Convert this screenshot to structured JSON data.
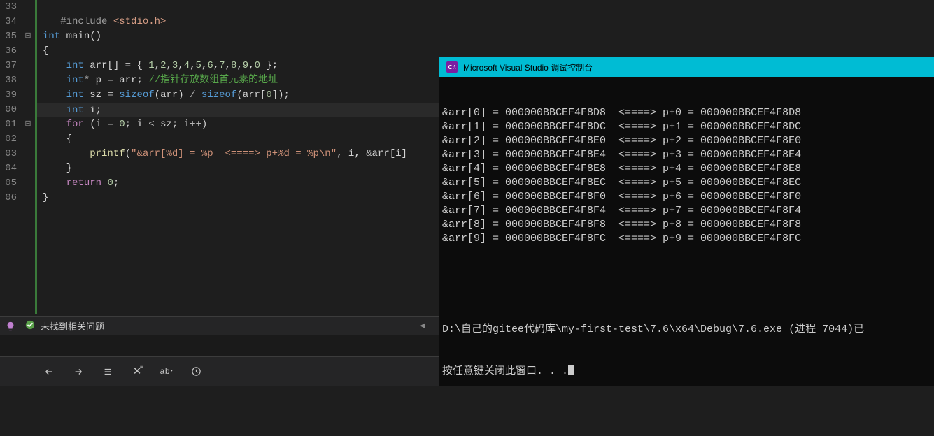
{
  "editor": {
    "lines": [
      {
        "num": "33",
        "marker": "",
        "html": ""
      },
      {
        "num": "34",
        "marker": "",
        "html": "   <span class='inc'>#include</span> <span class='strinc'>&lt;stdio.h&gt;</span>"
      },
      {
        "num": "35",
        "marker": "⊟",
        "html": "<span class='kw'>int</span> main()"
      },
      {
        "num": "36",
        "marker": "",
        "html": "{"
      },
      {
        "num": "37",
        "marker": "",
        "html": "    <span class='kw'>int</span> arr[] <span class='op'>=</span> { <span class='num'>1</span>,<span class='num'>2</span>,<span class='num'>3</span>,<span class='num'>4</span>,<span class='num'>5</span>,<span class='num'>6</span>,<span class='num'>7</span>,<span class='num'>8</span>,<span class='num'>9</span>,<span class='num'>0</span> };"
      },
      {
        "num": "38",
        "marker": "",
        "html": "    <span class='kw'>int</span><span class='op'>*</span> p <span class='op'>=</span> arr; <span class='cmt'>//指针存放数组首元素的地址</span>"
      },
      {
        "num": "39",
        "marker": "",
        "html": "    <span class='kw'>int</span> sz <span class='op'>=</span> <span class='kw'>sizeof</span>(arr) <span class='op'>/</span> <span class='kw'>sizeof</span>(arr[<span class='num'>0</span>]);"
      },
      {
        "num": "00",
        "marker": "",
        "html": "    <span class='kw'>int</span> i;",
        "hl": true
      },
      {
        "num": "01",
        "marker": "⊟",
        "html": "    <span class='kw2'>for</span> (i <span class='op'>=</span> <span class='num'>0</span>; i <span class='op'>&lt;</span> sz; i<span class='op'>++</span>)"
      },
      {
        "num": "02",
        "marker": "",
        "html": "    {"
      },
      {
        "num": "03",
        "marker": "",
        "html": "        <span class='func'>printf</span>(<span class='str'>\"&amp;arr[%d] = %p  &lt;====&gt; p+%d = %p\\n\"</span>, i, <span class='op'>&amp;</span>arr[i]"
      },
      {
        "num": "04",
        "marker": "",
        "html": "    }"
      },
      {
        "num": "05",
        "marker": "",
        "html": "    <span class='kw2'>return</span> <span class='num'>0</span>;"
      },
      {
        "num": "06",
        "marker": "",
        "html": "}"
      }
    ]
  },
  "status": {
    "text": "未找到相关问题"
  },
  "console": {
    "title": "Microsoft Visual Studio 调试控制台",
    "base_addr_prefix": "000000BBCEF4F8",
    "rows": [
      {
        "i": 0,
        "suf": "D8"
      },
      {
        "i": 1,
        "suf": "DC"
      },
      {
        "i": 2,
        "suf": "E0"
      },
      {
        "i": 3,
        "suf": "E4"
      },
      {
        "i": 4,
        "suf": "E8"
      },
      {
        "i": 5,
        "suf": "EC"
      },
      {
        "i": 6,
        "suf": "F0"
      },
      {
        "i": 7,
        "suf": "F4"
      },
      {
        "i": 8,
        "suf": "F8"
      },
      {
        "i": 9,
        "suf": "FC"
      }
    ],
    "footer1": "D:\\自己的gitee代码库\\my-first-test\\7.6\\x64\\Debug\\7.6.exe (进程 7044)已",
    "footer2": "按任意键关闭此窗口. . ."
  }
}
